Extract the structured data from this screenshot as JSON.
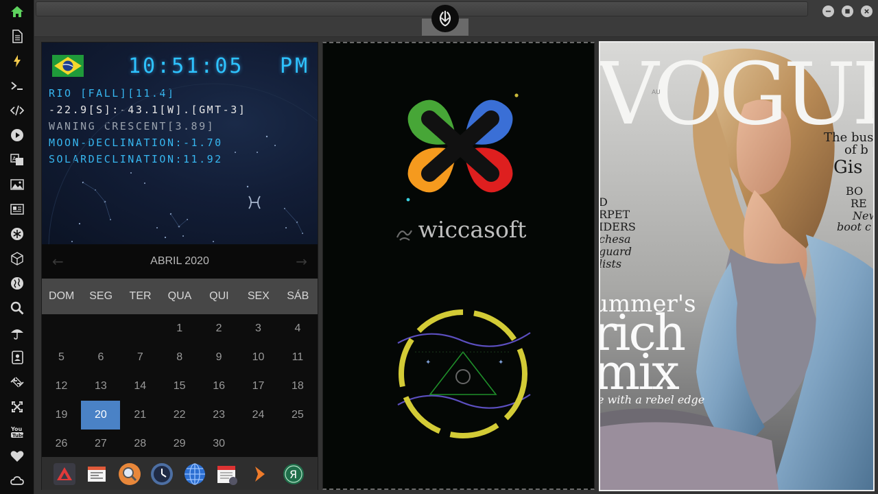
{
  "sidebar": {
    "items": [
      {
        "icon": "home-icon",
        "color": "#5ed25e"
      },
      {
        "icon": "document-icon",
        "color": "#d6d6d6"
      },
      {
        "icon": "lightning-icon",
        "color": "#f2c94c"
      },
      {
        "icon": "terminal-icon",
        "color": "#d6d6d6"
      },
      {
        "icon": "code-icon",
        "color": "#d6d6d6"
      },
      {
        "icon": "play-icon",
        "color": "#d6d6d6"
      },
      {
        "icon": "translate-icon",
        "color": "#d6d6d6"
      },
      {
        "icon": "image-icon",
        "color": "#d6d6d6"
      },
      {
        "icon": "news-icon",
        "color": "#d6d6d6"
      },
      {
        "icon": "aperture-icon",
        "color": "#d6d6d6"
      },
      {
        "icon": "cube-icon",
        "color": "#d6d6d6"
      },
      {
        "icon": "globe-icon",
        "color": "#d6d6d6"
      },
      {
        "icon": "search-icon",
        "color": "#d6d6d6"
      },
      {
        "icon": "umbrella-icon",
        "color": "#d6d6d6"
      },
      {
        "icon": "contacts-icon",
        "color": "#d6d6d6"
      },
      {
        "icon": "exchange-icon",
        "color": "#d6d6d6"
      },
      {
        "icon": "expand-icon",
        "color": "#d6d6d6"
      },
      {
        "icon": "youtube-icon",
        "color": "#d6d6d6"
      },
      {
        "icon": "heart-icon",
        "color": "#d6d6d6"
      },
      {
        "icon": "cloud-icon",
        "color": "#d6d6d6"
      }
    ]
  },
  "clock": {
    "time": "10:51:05",
    "ampm": "PM",
    "lines": [
      "RIO [FALL][11.4]",
      "-22.9[S]:-43.1[W].[GMT-3]",
      "WANING CRESCENT[3.89]",
      "MOON-DECLINATION:-1.70",
      "SOLARDECLINATION:11.92"
    ]
  },
  "calendar": {
    "title": "ABRIL 2020",
    "weekdays": [
      "DOM",
      "SEG",
      "TER",
      "QUA",
      "QUI",
      "SEX",
      "SÁB"
    ],
    "weeks": [
      [
        "",
        "",
        "",
        "1",
        "2",
        "3",
        "4"
      ],
      [
        "5",
        "6",
        "7",
        "8",
        "9",
        "10",
        "11"
      ],
      [
        "12",
        "13",
        "14",
        "15",
        "16",
        "17",
        "18"
      ],
      [
        "19",
        "20",
        "21",
        "22",
        "23",
        "24",
        "25"
      ],
      [
        "26",
        "27",
        "28",
        "29",
        "30",
        "",
        ""
      ]
    ],
    "today": "20",
    "accent": "#4a82c6"
  },
  "dock": {
    "apps": [
      "radiance-app-icon",
      "news-app-icon",
      "search-app-icon",
      "clock-app-icon",
      "browser-app-icon",
      "calendar-app-icon",
      "arrow-app-icon",
      "yandex-app-icon"
    ]
  },
  "branding": {
    "name": "wiccasoft"
  },
  "magazine": {
    "masthead": "VOGUE",
    "lines": [
      "The busi",
      "of b",
      "Gis",
      "BO",
      "RE",
      "New",
      "boot c",
      "D",
      "RPET",
      "IDERS",
      "chesa",
      "guard",
      "lists",
      "ummer's",
      "rich",
      "mix",
      "e with a rebel edge"
    ],
    "logo": "AU"
  }
}
